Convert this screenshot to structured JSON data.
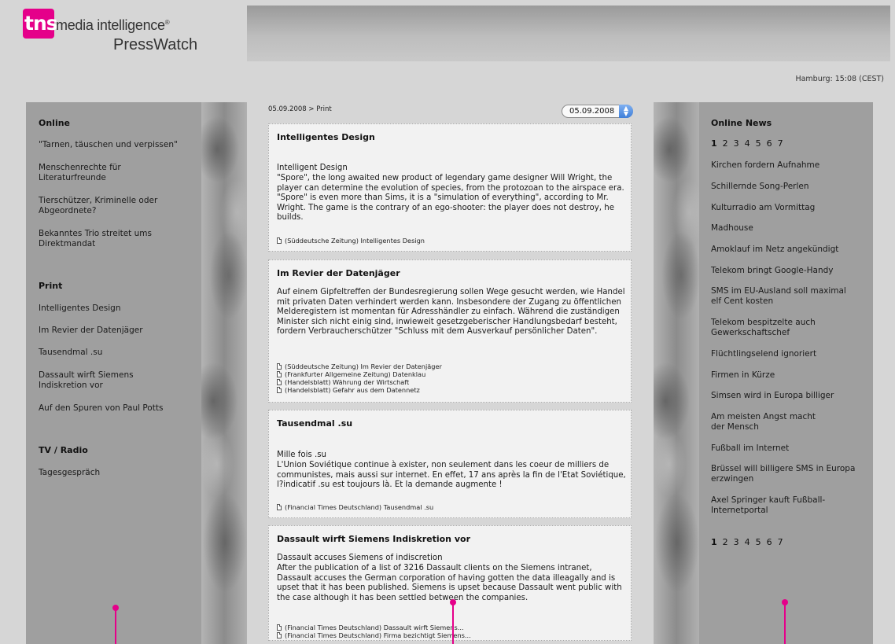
{
  "logo": {
    "tns": "tns",
    "media": "media intelligence",
    "tm": "®",
    "product": "PressWatch"
  },
  "clock": "Hamburg: 15:08 (CEST)",
  "breadcrumb": "05.09.2008 > Print",
  "date_select": {
    "value": "05.09.2008"
  },
  "left": {
    "online_title": "Online",
    "online": [
      "\"Tarnen, täuschen und verpissen\"",
      "Menschenrechte für Literaturfreunde",
      "Tierschützer, Kriminelle oder Abgeordnete?",
      "Bekanntes Trio streitet ums Direktmandat"
    ],
    "print_title": "Print",
    "print": [
      "Intelligentes Design",
      "Im Revier der Datenjäger",
      "Tausendmal .su",
      "Dassault wirft Siemens Indiskretion vor",
      "Auf den Spuren von Paul Potts"
    ],
    "tv_title": "TV / Radio",
    "tv": [
      "Tagesgespräch"
    ]
  },
  "right": {
    "title": "Online News",
    "pages": [
      "1",
      "2",
      "3",
      "4",
      "5",
      "6",
      "7"
    ],
    "news": [
      "Kirchen fordern Aufnahme",
      "Schillernde Song-Perlen",
      "Kulturradio am Vormittag",
      "Madhouse",
      "Amoklauf im Netz angekündigt",
      "Telekom bringt Google-Handy",
      "SMS im EU-Ausland soll maximal elf Cent kosten",
      "Telekom bespitzelte auch Gewerkschaftschef",
      "Flüchtlingselend ignoriert",
      "Firmen in Kürze",
      "Simsen wird in Europa billiger",
      "Am meisten Angst macht der Mensch",
      "Fußball im Internet",
      "Brüssel will billigere SMS in Europa erzwingen",
      "Axel Springer kauft Fußball-Internetportal"
    ]
  },
  "articles": [
    {
      "title": "Intelligentes Design",
      "subtitle": "Intelligent Design",
      "body": "\"Spore\", the long awaited new product of legendary game designer Will Wright, the player can determine the evolution of species, from the protozoan to the airspace era. \"Spore\" is even more than Sims, it is a \"simulation of everything\", according to Mr. Wright. The game is the contrary of an ego-shooter: the player does not destroy, he builds.",
      "sources": [
        "(Süddeutsche Zeitung) Intelligentes Design"
      ]
    },
    {
      "title": "Im Revier der Datenjäger",
      "subtitle": "",
      "body": "Auf einem Gipfeltreffen der Bundesregierung sollen Wege gesucht werden, wie Handel mit privaten Daten verhindert werden kann. Insbesondere der Zugang zu öffentlichen Melderegistern ist momentan für Adresshändler zu einfach. Während die zuständigen Minister sich nicht einig sind, inwieweit gesetzgeberischer Handlungsbedarf besteht, fordern Verbraucherschützer \"Schluss mit dem Ausverkauf persönlicher Daten\".",
      "sources": [
        "(Süddeutsche Zeitung) Im Revier der Datenjäger",
        "(Frankfurter Allgemeine Zeitung) Datenklau",
        "(Handelsblatt) Währung der Wirtschaft",
        "(Handelsblatt) Gefahr aus dem Datennetz"
      ]
    },
    {
      "title": "Tausendmal .su",
      "subtitle": "Mille fois .su",
      "body": "L'Union Soviétique continue à exister, non seulement dans les coeur de milliers de communistes, mais aussi sur internet. En effet, 17 ans après la fin de l'Etat Soviétique, l?indicatif .su est toujours là. Et la demande augmente !",
      "sources": [
        "(Financial Times Deutschland) Tausendmal .su"
      ]
    },
    {
      "title": "Dassault wirft Siemens Indiskretion vor",
      "subtitle": "Dassault accuses Siemens of indiscretion",
      "body": "After the publication of a list of 3216 Dassault clients on the Siemens intranet, Dassault accuses the German corporation of having gotten the data illeagally and is upset that it has been published. Siemens is upset because Dassault went public with the case although it has been settled between the companies.",
      "sources": [
        "(Financial Times Deutschland) Dassault wirft Siemens...",
        "(Financial Times Deutschland) Firma bezichtigt Siemens..."
      ]
    }
  ],
  "colors": {
    "brand_pink": "#e5008a",
    "side_panel": "#9f9f9f",
    "card_bg": "#f2f2f2"
  }
}
